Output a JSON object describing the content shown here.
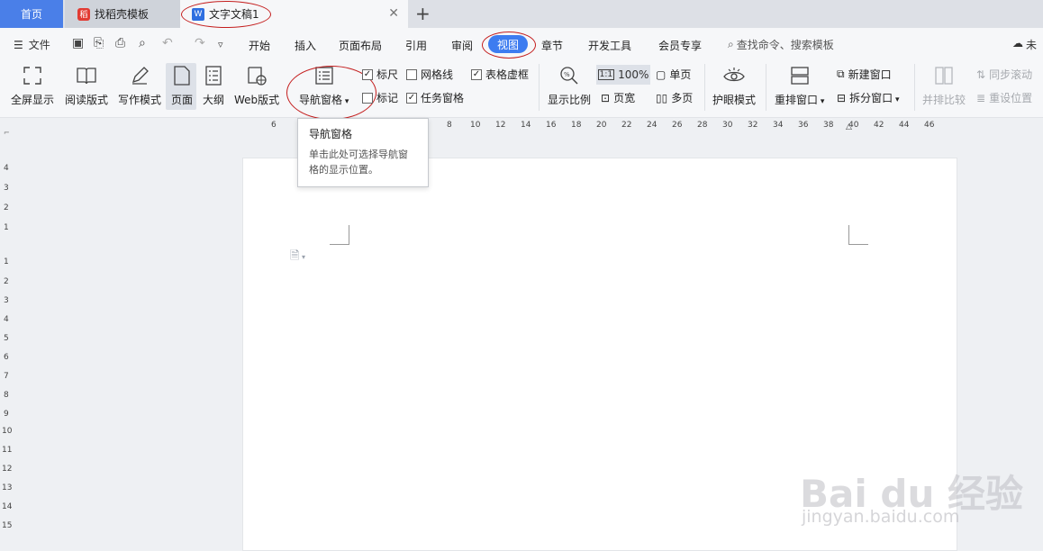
{
  "tabs": {
    "home": "首页",
    "template": "找稻壳模板",
    "document": "文字文稿1"
  },
  "menu": {
    "file": "文件",
    "items": [
      "开始",
      "插入",
      "页面布局",
      "引用",
      "审阅",
      "视图",
      "章节",
      "开发工具",
      "会员专享"
    ],
    "active": "视图",
    "search": "查找命令、搜索模板",
    "unsync": "未"
  },
  "ribbon": {
    "fullscreen": "全屏显示",
    "reading": "阅读版式",
    "writing": "写作模式",
    "page": "页面",
    "outline": "大纲",
    "web": "Web版式",
    "nav_pane": "导航窗格",
    "ruler": "标尺",
    "gridlines": "网格线",
    "table_border": "表格虚框",
    "mark": "标记",
    "task_pane": "任务窗格",
    "zoom": "显示比例",
    "zoom_100": "100%",
    "page_width": "页宽",
    "single": "单页",
    "multi": "多页",
    "eye": "护眼模式",
    "rearrange": "重排窗口",
    "new_window": "新建窗口",
    "split": "拆分窗口",
    "compare": "并排比较",
    "sync_scroll": "同步滚动",
    "reset_pos": "重设位置"
  },
  "checkbox_state": {
    "ruler": true,
    "gridlines": false,
    "table_border": true,
    "mark": false,
    "task_pane": true
  },
  "tooltip": {
    "title": "导航窗格",
    "desc": "单击此处可选择导航窗格的显示位置。"
  },
  "ruler_h": [
    "6",
    "8",
    "10",
    "12",
    "14",
    "16",
    "18",
    "20",
    "22",
    "24",
    "26",
    "28",
    "30",
    "32",
    "34",
    "36",
    "38",
    "40",
    "42",
    "44",
    "46"
  ],
  "ruler_v": [
    "4",
    "3",
    "2",
    "1",
    "1",
    "2",
    "3",
    "4",
    "5",
    "6",
    "7",
    "8",
    "9",
    "10",
    "11",
    "12",
    "13",
    "14",
    "15"
  ],
  "watermark": {
    "brand": "Bai du 经验",
    "url": "jingyan.baidu.com"
  },
  "colors": {
    "accent": "#3d7cf0",
    "home_tab": "#4a7fe8",
    "annotation": "#c41e1e"
  }
}
